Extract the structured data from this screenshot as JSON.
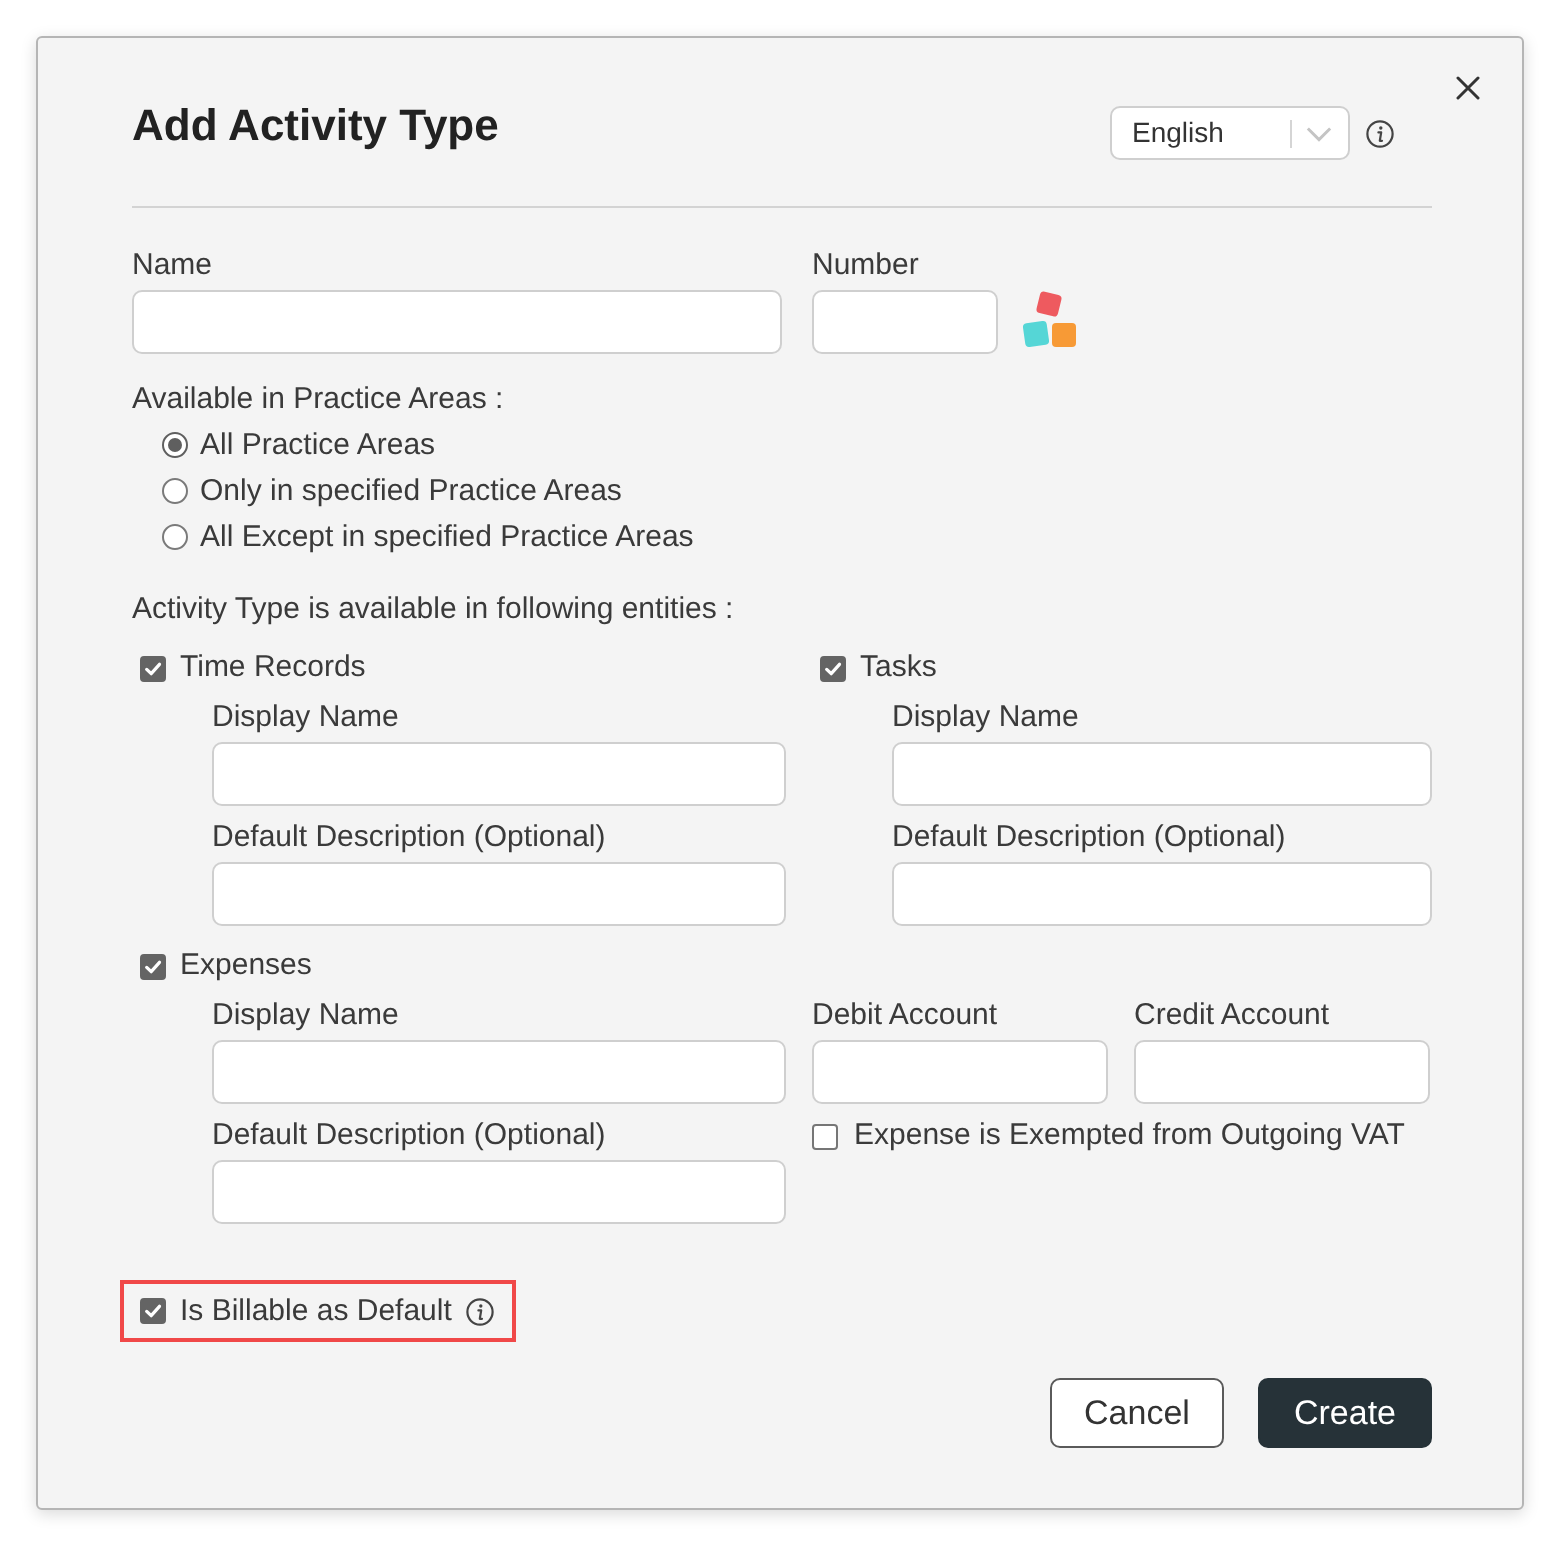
{
  "dialog": {
    "title": "Add Activity Type",
    "language": {
      "value": "English"
    }
  },
  "fields": [
    {
      "label": "Name",
      "kind": "text"
    },
    {
      "label": "Number",
      "kind": "number"
    }
  ],
  "practice_areas": {
    "label": "Available in Practice Areas :",
    "options": [
      {
        "label": "All Practice Areas",
        "selected": true
      },
      {
        "label": "Only in specified Practice Areas",
        "selected": false
      },
      {
        "label": "All Except in specified Practice Areas",
        "selected": false
      }
    ]
  },
  "entities": {
    "label": "Activity Type is available in following entities :",
    "items": [
      {
        "label": "Time Records",
        "checked": true,
        "fields": [
          {
            "label": "Display Name"
          },
          {
            "label": "Default Description (Optional)"
          }
        ]
      },
      {
        "label": "Tasks",
        "checked": true,
        "fields": [
          {
            "label": "Display Name"
          },
          {
            "label": "Default Description (Optional)"
          }
        ]
      },
      {
        "label": "Expenses",
        "checked": true,
        "fields": [
          {
            "label": "Display Name"
          },
          {
            "label": "Default Description (Optional)"
          }
        ],
        "accounts": [
          {
            "label": "Debit Account"
          },
          {
            "label": "Credit Account"
          }
        ],
        "vat_exempt": {
          "label": "Expense is Exempted from Outgoing VAT",
          "checked": false
        }
      }
    ]
  },
  "billable": {
    "label": "Is Billable as Default",
    "checked": true,
    "highlighted": true
  },
  "buttons": [
    {
      "label": "Cancel",
      "kind": "secondary"
    },
    {
      "label": "Create",
      "kind": "primary"
    }
  ]
}
